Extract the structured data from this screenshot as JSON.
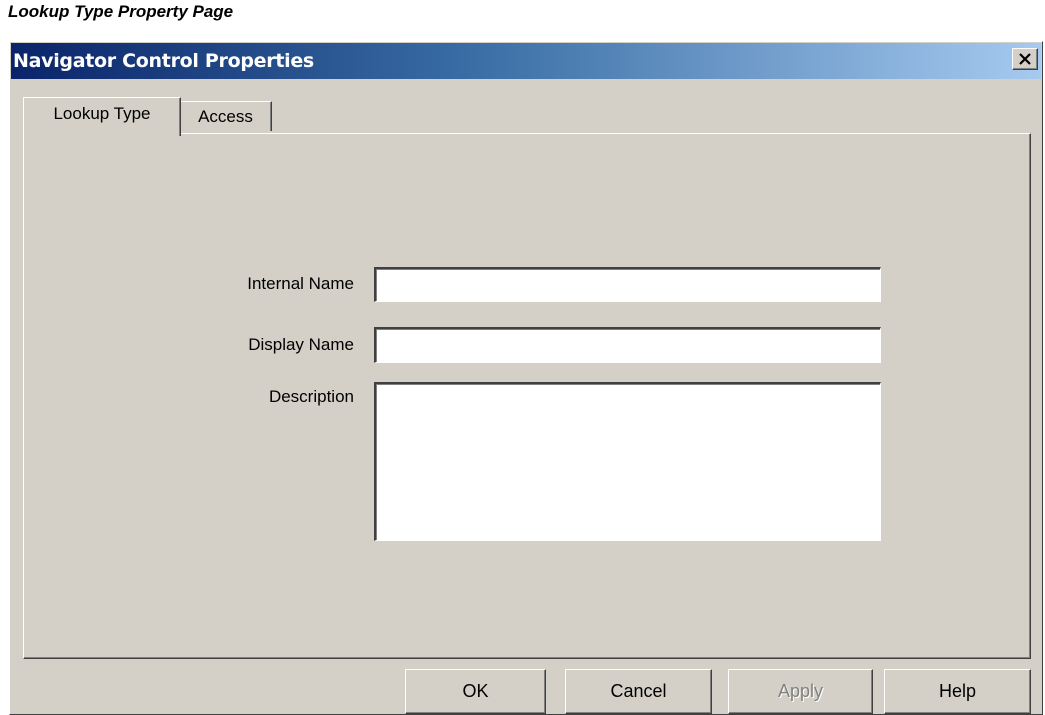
{
  "caption": "Lookup Type Property Page",
  "dialog": {
    "title": "Navigator Control Properties",
    "close_icon": "close-x-icon"
  },
  "tabs": [
    {
      "label": "Lookup Type",
      "active": true
    },
    {
      "label": "Access",
      "active": false
    }
  ],
  "form": {
    "internal_name": {
      "label": "Internal Name",
      "value": ""
    },
    "display_name": {
      "label": "Display Name",
      "value": ""
    },
    "description": {
      "label": "Description",
      "value": ""
    }
  },
  "buttons": {
    "ok": "OK",
    "cancel": "Cancel",
    "apply": "Apply",
    "help": "Help"
  },
  "colors": {
    "title_start": "#0a246a",
    "title_end": "#a6caf0",
    "face": "#d4d0c8"
  }
}
